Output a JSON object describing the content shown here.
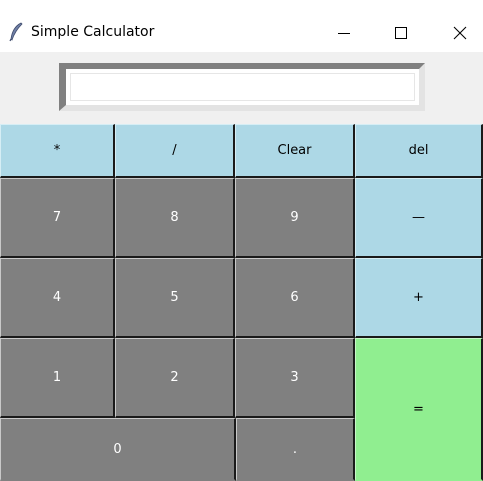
{
  "window": {
    "title": "Simple Calculator",
    "controls": {
      "minimize": "minimize",
      "maximize": "maximize",
      "close": "close"
    }
  },
  "display": {
    "value": ""
  },
  "keys": {
    "multiply": "*",
    "divide": "/",
    "clear": "Clear",
    "delete": "del",
    "seven": "7",
    "eight": "8",
    "nine": "9",
    "minus": "—",
    "four": "4",
    "five": "5",
    "six": "6",
    "plus": "+",
    "one": "1",
    "two": "2",
    "three": "3",
    "equals": "=",
    "zero": "0",
    "decimal": "."
  },
  "colors": {
    "operator_key": "#add8e6",
    "digit_key": "#808080",
    "equals_key": "#90ee90",
    "window_background": "#f0f0f0"
  },
  "icons": {
    "app": "feather-icon",
    "minimize": "minimize-icon",
    "maximize": "maximize-icon",
    "close": "close-icon"
  }
}
